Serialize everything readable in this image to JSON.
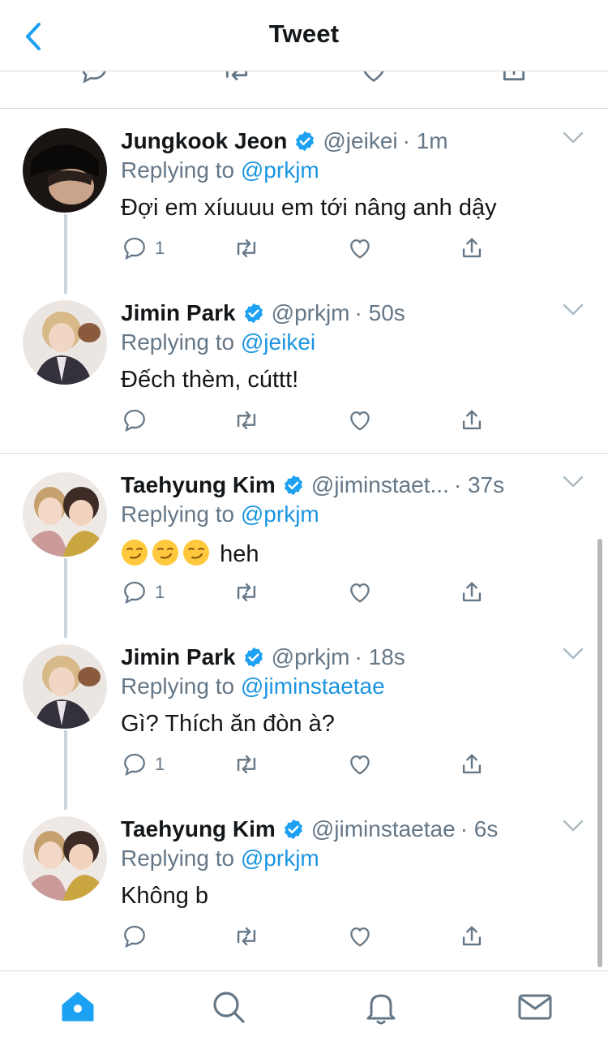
{
  "header": {
    "title": "Tweet"
  },
  "tweets": [
    {
      "name": "Jungkook Jeon",
      "handle": "@jeikei",
      "time": "· 1m",
      "replying_prefix": "Replying to",
      "replying_to": "@prkjm",
      "text": "Đợi em xíuuuu em tới nâng anh dậy",
      "reply_count": "1"
    },
    {
      "name": "Jimin Park",
      "handle": "@prkjm",
      "time": "· 50s",
      "replying_prefix": "Replying to",
      "replying_to": "@jeikei",
      "text": "Đếch thèm, cúttt!",
      "reply_count": ""
    },
    {
      "name": "Taehyung Kim",
      "handle": "@jiminstaet...",
      "time": "· 37s",
      "replying_prefix": "Replying to",
      "replying_to": "@prkjm",
      "text": "heh",
      "reply_count": "1"
    },
    {
      "name": "Jimin Park",
      "handle": "@prkjm",
      "time": "· 18s",
      "replying_prefix": "Replying to",
      "replying_to": "@jiminstaetae",
      "text": "Gì? Thích ăn đòn à?",
      "reply_count": "1"
    },
    {
      "name": "Taehyung Kim",
      "handle": "@jiminstaetae",
      "time": "· 6s",
      "replying_prefix": "Replying to",
      "replying_to": "@prkjm",
      "text": "Không b",
      "reply_count": ""
    }
  ],
  "icons": {
    "back": "chevron-left-icon",
    "reply": "comment-icon",
    "retweet": "retweet-icon",
    "like": "heart-icon",
    "share": "share-icon",
    "verified": "verified-badge-icon",
    "caret": "chevron-down-icon",
    "tabs": [
      "home-icon",
      "search-icon",
      "bell-icon",
      "mail-icon"
    ]
  },
  "colors": {
    "accent": "#1da1f2",
    "link": "#1b95e0",
    "muted": "#657786",
    "text": "#14171a",
    "divider": "#d5dbe0"
  }
}
